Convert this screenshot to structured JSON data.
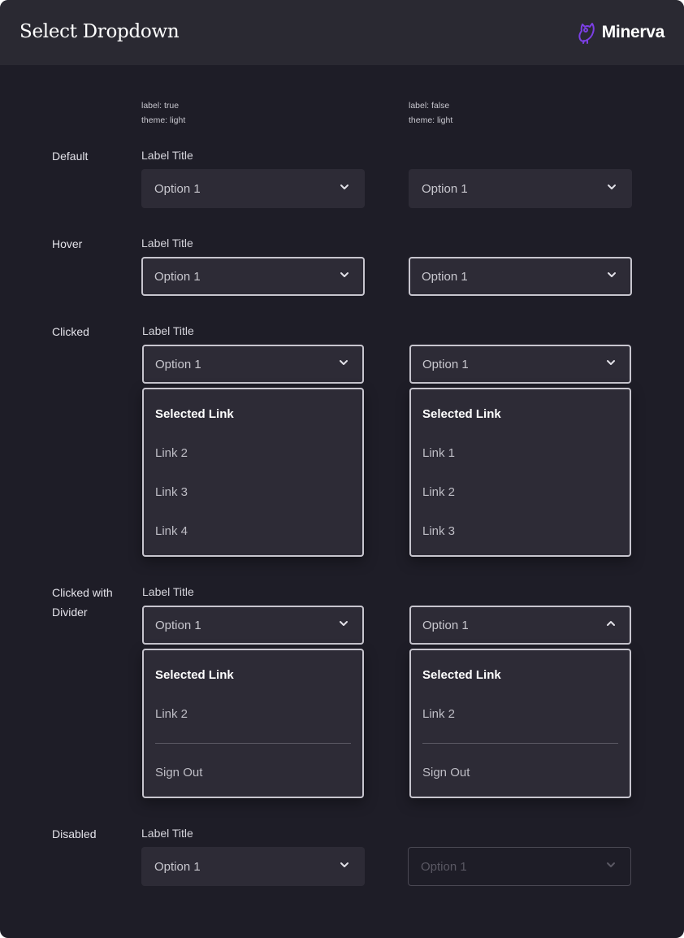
{
  "header": {
    "title": "Select Dropdown",
    "brand": "Minerva",
    "brand_color": "#7b3fe4"
  },
  "columns": [
    {
      "meta_label": "label: true",
      "meta_theme": "theme: light"
    },
    {
      "meta_label": "label: false",
      "meta_theme": "theme: light"
    }
  ],
  "rows": {
    "default": "Default",
    "hover": "Hover",
    "clicked": "Clicked",
    "clicked_divider_1": "Clicked with",
    "clicked_divider_2": "Divider",
    "disabled": "Disabled"
  },
  "field_label": "Label Title",
  "selected_value": "Option 1",
  "menus": {
    "clicked_left": [
      "Selected Link",
      "Link 2",
      "Link 3",
      "Link 4"
    ],
    "clicked_right": [
      "Selected Link",
      "Link 1",
      "Link 2",
      "Link 3"
    ],
    "divider_left": [
      "Selected Link",
      "Link 2",
      "Sign Out"
    ],
    "divider_right": [
      "Selected Link",
      "Link 2",
      "Sign Out"
    ]
  },
  "icons": {
    "brand": "owl-icon",
    "chevron": "chevron-down-icon",
    "chevron_open": "chevron-up-icon"
  }
}
